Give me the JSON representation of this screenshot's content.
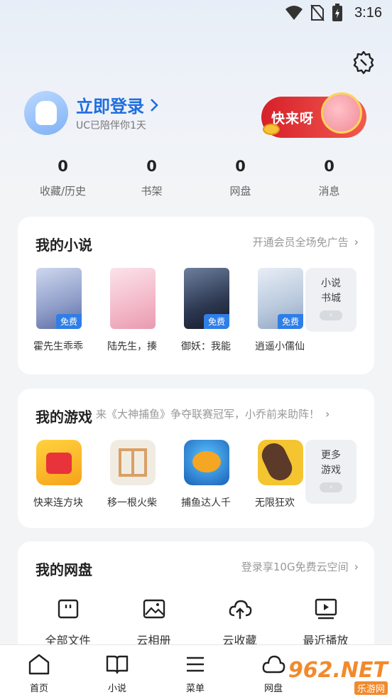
{
  "status_bar": {
    "time": "3:16",
    "icons": [
      "wifi-icon",
      "no-sim-icon",
      "battery-charging-icon"
    ]
  },
  "profile": {
    "login_title": "立即登录",
    "login_sub": "UC已陪伴你1天",
    "promo_text": "快来呀"
  },
  "stats": [
    {
      "value": "0",
      "label": "收藏/历史"
    },
    {
      "value": "0",
      "label": "书架"
    },
    {
      "value": "0",
      "label": "网盘"
    },
    {
      "value": "0",
      "label": "消息"
    }
  ],
  "novels": {
    "title": "我的小说",
    "link": "开通会员全场免广告",
    "badge": "免费",
    "items": [
      {
        "label": "霍先生乖乖"
      },
      {
        "label": "陆先生，揍"
      },
      {
        "label": "御妖：我能"
      },
      {
        "label": "逍遥小儒仙"
      }
    ],
    "more_line1": "小说",
    "more_line2": "书城"
  },
  "games": {
    "title": "我的游戏",
    "link": "来《大神捕鱼》争夺联赛冠军，小乔前来助阵！",
    "items": [
      {
        "label": "快来连方块"
      },
      {
        "label": "移一根火柴"
      },
      {
        "label": "捕鱼达人千"
      },
      {
        "label": "无限狂欢"
      }
    ],
    "more_line1": "更多",
    "more_line2": "游戏"
  },
  "disk": {
    "title": "我的网盘",
    "link": "登录享10G免费云空间",
    "items": [
      {
        "label": "全部文件",
        "icon": "folder-icon"
      },
      {
        "label": "云相册",
        "icon": "photo-icon"
      },
      {
        "label": "云收藏",
        "icon": "cloud-upload-icon"
      },
      {
        "label": "最近播放",
        "icon": "video-icon"
      }
    ]
  },
  "bottom_nav": [
    {
      "label": "首页",
      "icon": "home-icon"
    },
    {
      "label": "小说",
      "icon": "book-icon"
    },
    {
      "label": "菜单",
      "icon": "menu-icon"
    },
    {
      "label": "网盘",
      "icon": "cloud-icon"
    }
  ],
  "watermark": {
    "big": "962.NET",
    "small": "乐游网"
  },
  "colors": {
    "accent": "#1e6ee0",
    "free_badge": "#2f7ee8",
    "promo": "#d6202a"
  }
}
